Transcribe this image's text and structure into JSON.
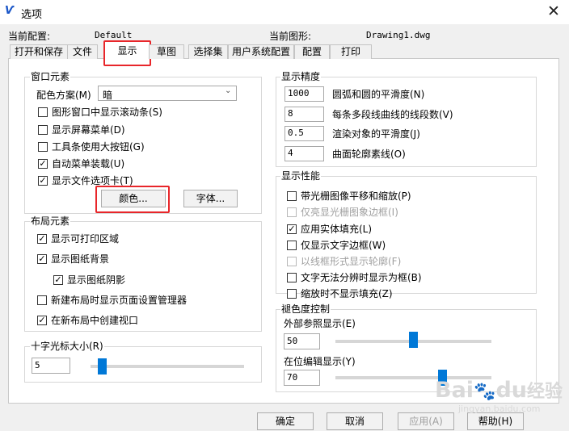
{
  "window": {
    "title": "选项",
    "close": "✕"
  },
  "header": {
    "current_profile_label": "当前配置:",
    "current_profile_value": "Default",
    "current_drawing_label": "当前图形:",
    "current_drawing_value": "Drawing1.dwg"
  },
  "tabs": [
    {
      "label": "打开和保存"
    },
    {
      "label": "文件"
    },
    {
      "label": "显示"
    },
    {
      "label": "草图"
    },
    {
      "label": "选择集"
    },
    {
      "label": "用户系统配置"
    },
    {
      "label": "配置"
    },
    {
      "label": "打印"
    }
  ],
  "active_tab": "显示",
  "window_elements": {
    "title": "窗口元素",
    "color_scheme_label": "配色方案(M)",
    "color_scheme_value": "暗",
    "options": [
      {
        "label": "图形窗口中显示滚动条(S)",
        "checked": false
      },
      {
        "label": "显示屏幕菜单(D)",
        "checked": false
      },
      {
        "label": "工具条使用大按钮(G)",
        "checked": false
      },
      {
        "label": "自动菜单装载(U)",
        "checked": true
      },
      {
        "label": "显示文件选项卡(T)",
        "checked": true
      }
    ],
    "colors_button": "颜色...",
    "fonts_button": "字体..."
  },
  "layout_elements": {
    "title": "布局元素",
    "options": [
      {
        "label": "显示可打印区域",
        "checked": true
      },
      {
        "label": "显示图纸背景",
        "checked": true
      },
      {
        "label": "显示图纸阴影",
        "checked": true
      },
      {
        "label": "新建布局时显示页面设置管理器",
        "checked": false
      },
      {
        "label": "在新布局中创建视口",
        "checked": true
      }
    ]
  },
  "crosshair": {
    "title": "十字光标大小(R)",
    "value": "5",
    "slider_fraction": 0.05
  },
  "display_resolution": {
    "title": "显示精度",
    "items": [
      {
        "value": "1000",
        "label": "圆弧和圆的平滑度(N)"
      },
      {
        "value": "8",
        "label": "每条多段线曲线的线段数(V)"
      },
      {
        "value": "0.5",
        "label": "渲染对象的平滑度(J)"
      },
      {
        "value": "4",
        "label": "曲面轮廓素线(O)"
      }
    ]
  },
  "display_performance": {
    "title": "显示性能",
    "options": [
      {
        "label": "带光栅图像平移和缩放(P)",
        "checked": false,
        "disabled": false
      },
      {
        "label": "仅亮显光栅图象边框(I)",
        "checked": false,
        "disabled": true
      },
      {
        "label": "应用实体填充(L)",
        "checked": true,
        "disabled": false
      },
      {
        "label": "仅显示文字边框(W)",
        "checked": false,
        "disabled": false
      },
      {
        "label": "以线框形式显示轮廓(F)",
        "checked": false,
        "disabled": true
      },
      {
        "label": "文字无法分辨时显示为框(B)",
        "checked": false,
        "disabled": false
      },
      {
        "label": "缩放时不显示填充(Z)",
        "checked": false,
        "disabled": false
      }
    ]
  },
  "fade_control": {
    "title": "褪色度控制",
    "xref_label": "外部参照显示(E)",
    "xref_value": "50",
    "xref_fraction": 0.5,
    "inplace_label": "在位编辑显示(Y)",
    "inplace_value": "70",
    "inplace_fraction": 0.7
  },
  "buttons": {
    "ok": "确定",
    "cancel": "取消",
    "apply": "应用(A)",
    "help": "帮助(H)"
  },
  "watermark": {
    "brand": "Bai",
    "paw": "🐾",
    "brand2": "du",
    "text": "经验",
    "url": "jingyan.baidu.com"
  },
  "colors": {
    "highlight": "#e8262a",
    "slider_thumb": "#0078d7"
  }
}
